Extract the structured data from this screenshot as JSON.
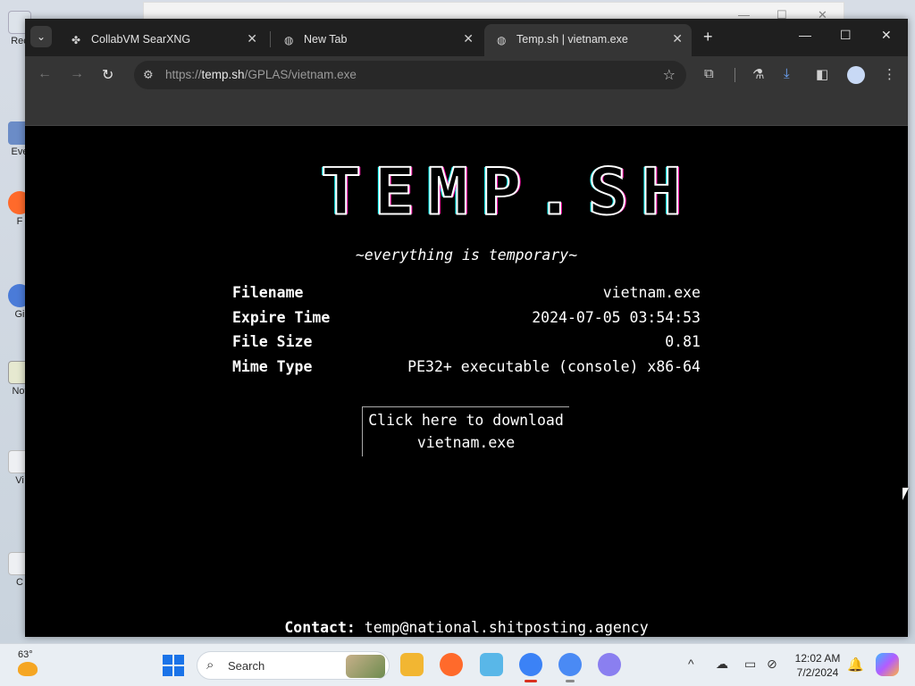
{
  "desktop": {
    "icons": [
      "Rec",
      "Eve",
      "F",
      "Gi",
      "Not",
      "Vi",
      "C"
    ]
  },
  "browser": {
    "tabs": [
      {
        "title": "CollabVM SearXNG",
        "close": "✕"
      },
      {
        "title": "New Tab",
        "close": "✕"
      },
      {
        "title": "Temp.sh | vietnam.exe",
        "close": "✕"
      }
    ],
    "tab_list_glyph": "⌄",
    "new_tab_glyph": "+",
    "window_controls": {
      "minimize": "—",
      "maximize": "☐",
      "close": "✕"
    },
    "nav": {
      "back": "←",
      "forward": "→",
      "reload": "↻"
    },
    "address": {
      "scheme": "https://",
      "host": "temp.sh",
      "path": "/GPLAS/vietnam.exe"
    },
    "toolbar_icons": [
      "extensions-icon",
      "labs-icon",
      "download-icon",
      "side-panel-icon",
      "profile-icon",
      "menu-icon"
    ]
  },
  "page": {
    "logo": "TEMP.SH",
    "tagline": "~everything is temporary~",
    "info": [
      {
        "label": "Filename",
        "value": "vietnam.exe"
      },
      {
        "label": "Expire Time",
        "value": "2024-07-05 03:54:53"
      },
      {
        "label": "File Size",
        "value": "0.81"
      },
      {
        "label": "Mime Type",
        "value": "PE32+ executable (console) x86-64"
      }
    ],
    "download": {
      "line1": "Click here to download",
      "line2": "vietnam.exe"
    },
    "contact": {
      "label": "Contact:",
      "email": "temp@national.shitposting.agency"
    }
  },
  "taskbar": {
    "weather_temp": "63°",
    "search_placeholder": "Search",
    "clock_time": "12:02 AM",
    "clock_date": "7/2/2024",
    "tray_chevron": "^"
  }
}
